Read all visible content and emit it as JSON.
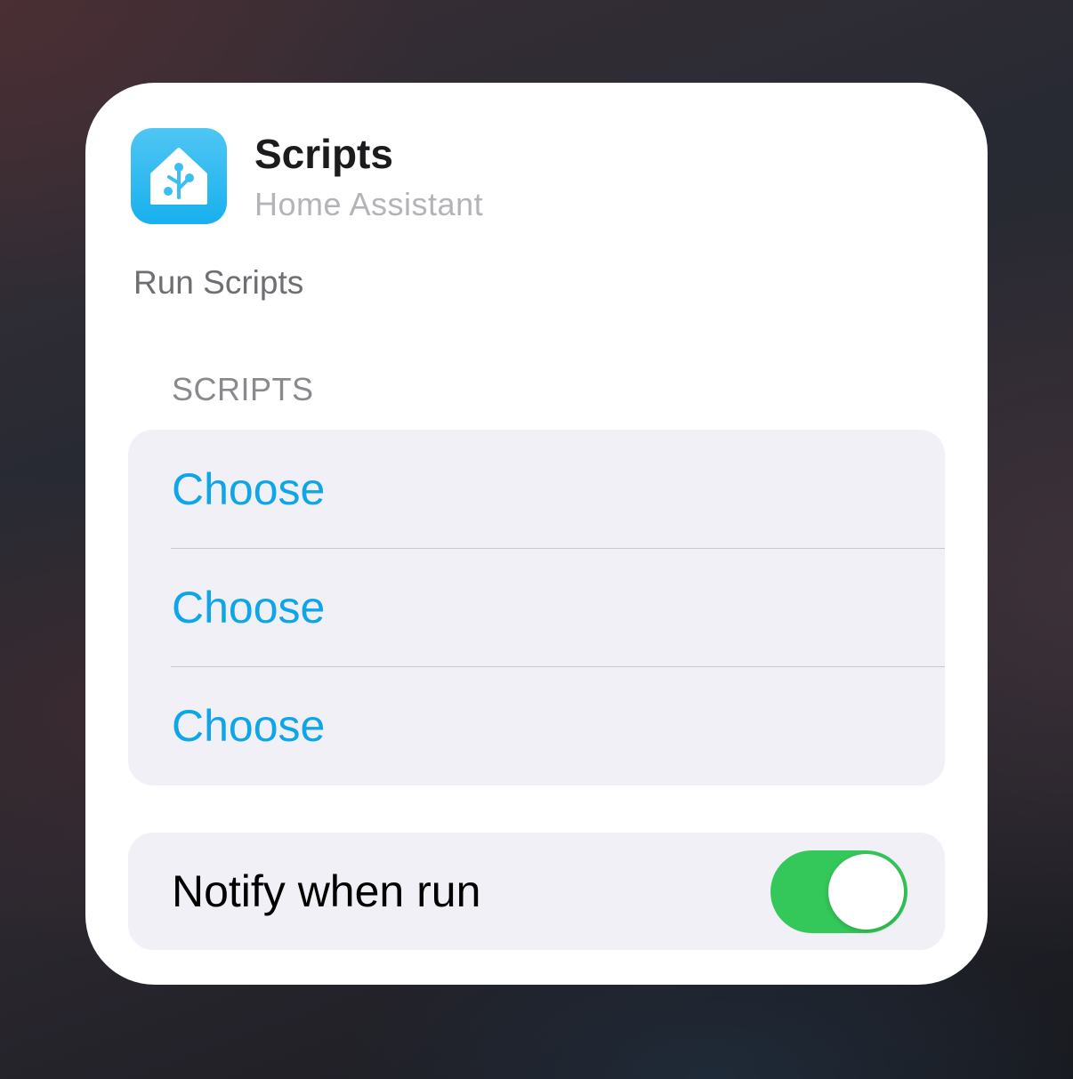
{
  "header": {
    "title": "Scripts",
    "subtitle": "Home Assistant",
    "icon": "home-assistant-icon",
    "icon_color": "#18b0ee"
  },
  "action": {
    "description": "Run Scripts"
  },
  "scripts_section": {
    "header": "SCRIPTS",
    "items": [
      {
        "label": "Choose"
      },
      {
        "label": "Choose"
      },
      {
        "label": "Choose"
      }
    ],
    "link_color": "#0ea5e9"
  },
  "notify": {
    "label": "Notify when run",
    "enabled": true,
    "on_color": "#34c759"
  }
}
